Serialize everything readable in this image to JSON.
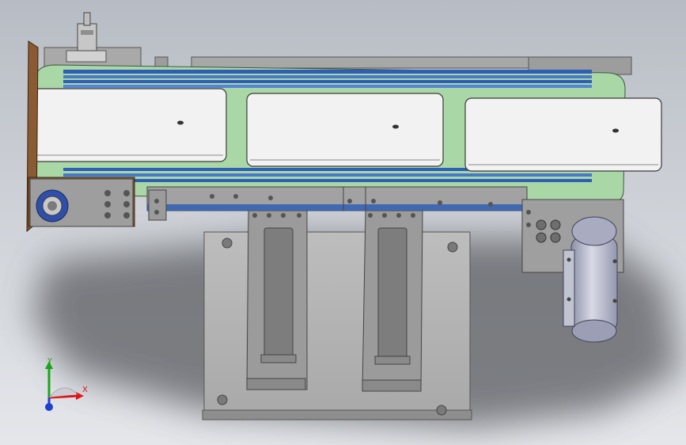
{
  "viewport": {
    "background_top": "#b7bcc4",
    "background_bottom": "#e4e6ea"
  },
  "model": {
    "belt_frame_color": "#9fcf9f",
    "belt_stripe_color": "#2f5fb5",
    "pallet_color": "#f2f2f2",
    "bracket_color": "#a8a8a8",
    "end_plate_color": "#8a5a32",
    "motor_color": "#b9bccf"
  },
  "triad": {
    "x_label": "X",
    "y_label": "Y",
    "x_color": "#e01414",
    "y_color": "#1aa51a",
    "z_color": "#1f3fd0"
  }
}
